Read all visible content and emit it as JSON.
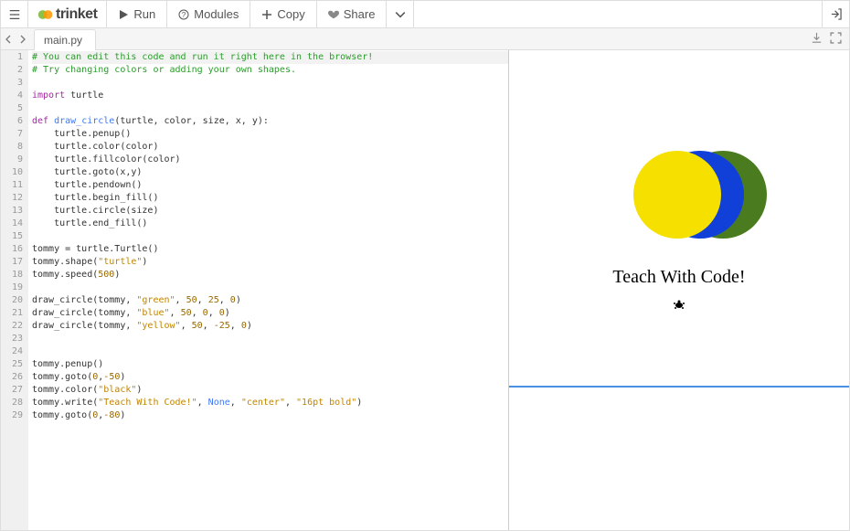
{
  "toolbar": {
    "run_label": "Run",
    "modules_label": "Modules",
    "copy_label": "Copy",
    "share_label": "Share"
  },
  "brand": "trinket",
  "tab": {
    "filename": "main.py"
  },
  "code": {
    "lines": [
      {
        "num": 1,
        "highlight": true,
        "tokens": [
          {
            "cls": "c-comment",
            "t": "# You can edit this code and run it right here in the browser!"
          }
        ]
      },
      {
        "num": 2,
        "tokens": [
          {
            "cls": "c-comment",
            "t": "# Try changing colors or adding your own shapes."
          }
        ]
      },
      {
        "num": 3,
        "tokens": []
      },
      {
        "num": 4,
        "tokens": [
          {
            "cls": "c-keyword",
            "t": "import"
          },
          {
            "cls": "",
            "t": " turtle"
          }
        ]
      },
      {
        "num": 5,
        "tokens": []
      },
      {
        "num": 6,
        "fold": true,
        "tokens": [
          {
            "cls": "c-keyword",
            "t": "def"
          },
          {
            "cls": "",
            "t": " "
          },
          {
            "cls": "c-def",
            "t": "draw_circle"
          },
          {
            "cls": "",
            "t": "(turtle, color, size, x, y):"
          }
        ]
      },
      {
        "num": 7,
        "tokens": [
          {
            "cls": "",
            "t": "    turtle.penup()"
          }
        ]
      },
      {
        "num": 8,
        "tokens": [
          {
            "cls": "",
            "t": "    turtle.color(color)"
          }
        ]
      },
      {
        "num": 9,
        "tokens": [
          {
            "cls": "",
            "t": "    turtle.fillcolor(color)"
          }
        ]
      },
      {
        "num": 10,
        "tokens": [
          {
            "cls": "",
            "t": "    turtle.goto(x,y)"
          }
        ]
      },
      {
        "num": 11,
        "tokens": [
          {
            "cls": "",
            "t": "    turtle.pendown()"
          }
        ]
      },
      {
        "num": 12,
        "tokens": [
          {
            "cls": "",
            "t": "    turtle.begin_fill()"
          }
        ]
      },
      {
        "num": 13,
        "tokens": [
          {
            "cls": "",
            "t": "    turtle.circle(size)"
          }
        ]
      },
      {
        "num": 14,
        "tokens": [
          {
            "cls": "",
            "t": "    turtle.end_fill()"
          }
        ]
      },
      {
        "num": 15,
        "tokens": []
      },
      {
        "num": 16,
        "tokens": [
          {
            "cls": "",
            "t": "tommy = turtle.Turtle()"
          }
        ]
      },
      {
        "num": 17,
        "tokens": [
          {
            "cls": "",
            "t": "tommy.shape("
          },
          {
            "cls": "c-string",
            "t": "\"turtle\""
          },
          {
            "cls": "",
            "t": ")"
          }
        ]
      },
      {
        "num": 18,
        "tokens": [
          {
            "cls": "",
            "t": "tommy.speed("
          },
          {
            "cls": "c-number",
            "t": "500"
          },
          {
            "cls": "",
            "t": ")"
          }
        ]
      },
      {
        "num": 19,
        "tokens": []
      },
      {
        "num": 20,
        "tokens": [
          {
            "cls": "",
            "t": "draw_circle(tommy, "
          },
          {
            "cls": "c-string",
            "t": "\"green\""
          },
          {
            "cls": "",
            "t": ", "
          },
          {
            "cls": "c-number",
            "t": "50"
          },
          {
            "cls": "",
            "t": ", "
          },
          {
            "cls": "c-number",
            "t": "25"
          },
          {
            "cls": "",
            "t": ", "
          },
          {
            "cls": "c-number",
            "t": "0"
          },
          {
            "cls": "",
            "t": ")"
          }
        ]
      },
      {
        "num": 21,
        "tokens": [
          {
            "cls": "",
            "t": "draw_circle(tommy, "
          },
          {
            "cls": "c-string",
            "t": "\"blue\""
          },
          {
            "cls": "",
            "t": ", "
          },
          {
            "cls": "c-number",
            "t": "50"
          },
          {
            "cls": "",
            "t": ", "
          },
          {
            "cls": "c-number",
            "t": "0"
          },
          {
            "cls": "",
            "t": ", "
          },
          {
            "cls": "c-number",
            "t": "0"
          },
          {
            "cls": "",
            "t": ")"
          }
        ]
      },
      {
        "num": 22,
        "tokens": [
          {
            "cls": "",
            "t": "draw_circle(tommy, "
          },
          {
            "cls": "c-string",
            "t": "\"yellow\""
          },
          {
            "cls": "",
            "t": ", "
          },
          {
            "cls": "c-number",
            "t": "50"
          },
          {
            "cls": "",
            "t": ", "
          },
          {
            "cls": "c-number",
            "t": "-25"
          },
          {
            "cls": "",
            "t": ", "
          },
          {
            "cls": "c-number",
            "t": "0"
          },
          {
            "cls": "",
            "t": ")"
          }
        ]
      },
      {
        "num": 23,
        "tokens": []
      },
      {
        "num": 24,
        "tokens": []
      },
      {
        "num": 25,
        "tokens": [
          {
            "cls": "",
            "t": "tommy.penup()"
          }
        ]
      },
      {
        "num": 26,
        "tokens": [
          {
            "cls": "",
            "t": "tommy.goto("
          },
          {
            "cls": "c-number",
            "t": "0"
          },
          {
            "cls": "",
            "t": ","
          },
          {
            "cls": "c-number",
            "t": "-50"
          },
          {
            "cls": "",
            "t": ")"
          }
        ]
      },
      {
        "num": 27,
        "tokens": [
          {
            "cls": "",
            "t": "tommy.color("
          },
          {
            "cls": "c-string",
            "t": "\"black\""
          },
          {
            "cls": "",
            "t": ")"
          }
        ]
      },
      {
        "num": 28,
        "tokens": [
          {
            "cls": "",
            "t": "tommy.write("
          },
          {
            "cls": "c-string",
            "t": "\"Teach With Code!\""
          },
          {
            "cls": "",
            "t": ", "
          },
          {
            "cls": "c-builtin",
            "t": "None"
          },
          {
            "cls": "",
            "t": ", "
          },
          {
            "cls": "c-string",
            "t": "\"center\""
          },
          {
            "cls": "",
            "t": ", "
          },
          {
            "cls": "c-string",
            "t": "\"16pt bold\""
          },
          {
            "cls": "",
            "t": ")"
          }
        ]
      },
      {
        "num": 29,
        "tokens": [
          {
            "cls": "",
            "t": "tommy.goto("
          },
          {
            "cls": "c-number",
            "t": "0"
          },
          {
            "cls": "",
            "t": ","
          },
          {
            "cls": "c-number",
            "t": "-80"
          },
          {
            "cls": "",
            "t": ")"
          }
        ]
      }
    ]
  },
  "output": {
    "text": "Teach With Code!",
    "circles": [
      {
        "color": "green",
        "offset": 25
      },
      {
        "color": "blue",
        "offset": 0
      },
      {
        "color": "yellow",
        "offset": -25
      }
    ]
  }
}
